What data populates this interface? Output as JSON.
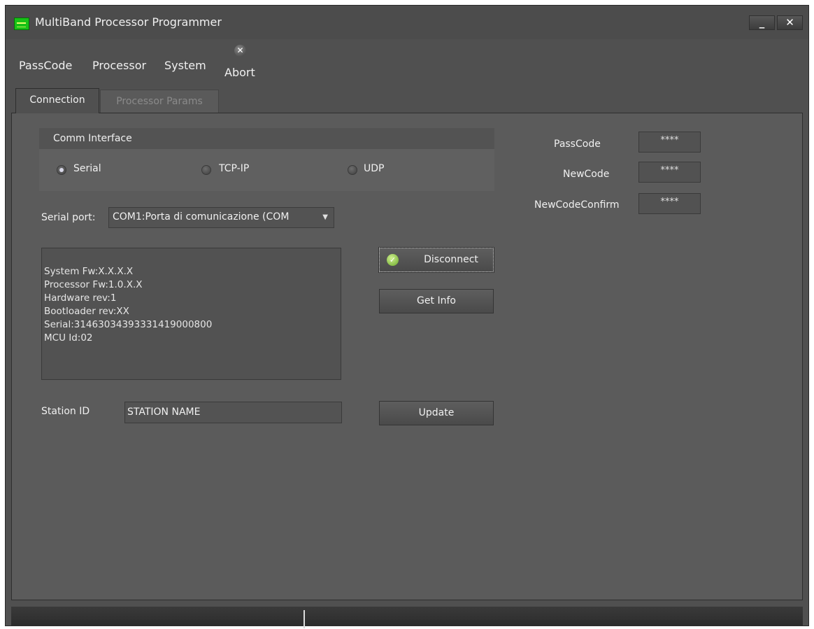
{
  "window": {
    "title": "MultiBand Processor Programmer",
    "minimize_label": "_",
    "close_label": "✕"
  },
  "menu": {
    "items": [
      "PassCode",
      "Processor",
      "System"
    ],
    "abort_label": "Abort"
  },
  "tabs": [
    {
      "label": "Connection",
      "active": true
    },
    {
      "label": "Processor Params",
      "active": false
    }
  ],
  "comm_interface": {
    "title": "Comm Interface",
    "options": [
      {
        "label": "Serial",
        "checked": true
      },
      {
        "label": "TCP-IP",
        "checked": false
      },
      {
        "label": "UDP",
        "checked": false
      }
    ]
  },
  "serial_port": {
    "label": "Serial port:",
    "value": "COM1:Porta di comunicazione (COM"
  },
  "info_lines": [
    "System Fw:X.X.X.X",
    "Processor Fw:1.0.X.X",
    "Hardware rev:1",
    "Bootloader rev:XX",
    "Serial:31463034393331419000800",
    "MCU Id:02"
  ],
  "buttons": {
    "disconnect": "Disconnect",
    "get_info": "Get Info",
    "update": "Update"
  },
  "station": {
    "label": "Station ID",
    "value": "STATION NAME"
  },
  "passcodes": {
    "passcode_label": "PassCode",
    "passcode_value": "****",
    "newcode_label": "NewCode",
    "newcode_value": "****",
    "confirm_label": "NewCodeConfirm",
    "confirm_value": "****"
  },
  "icons": {
    "app": "equalizer-icon",
    "abort": "abort-x-icon",
    "connected": "check-icon"
  },
  "colors": {
    "background": "#505050",
    "panel": "#5b5b5b",
    "app_icon": "#17c217"
  }
}
